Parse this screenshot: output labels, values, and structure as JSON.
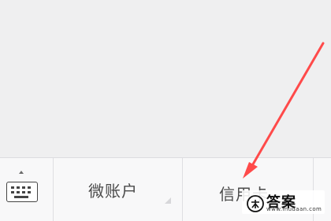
{
  "bottom_bar": {
    "keyboard": {
      "icon": "keyboard-icon",
      "indicator": "chevron-up-icon"
    },
    "tabs": [
      {
        "label": "微账户"
      },
      {
        "label": "信用卡"
      }
    ]
  },
  "annotation": {
    "color": "#ff4a4a",
    "type": "arrow"
  },
  "watermark": {
    "title": "答案",
    "url": "www.mudaan.com"
  }
}
